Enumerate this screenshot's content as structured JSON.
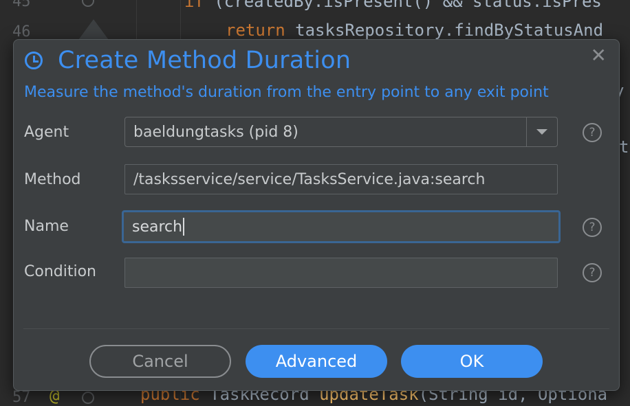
{
  "editor": {
    "line_45": {
      "number": "45",
      "code_kw": "if",
      "code_rest": " (createdBy.isPresent() && status.isPres"
    },
    "line_46": {
      "number": "46",
      "code_kw": "return",
      "code_rest": " tasksRepository.findByStatusAnd"
    },
    "line_57": {
      "number": "57",
      "annotation": "@",
      "code_kw": "public",
      "code_type": " TaskRecord ",
      "code_fn": "updateTask",
      "code_rest": "(String id, Optiona"
    },
    "right_edge_fragments": [
      "y",
      "t"
    ]
  },
  "dialog": {
    "title": "Create Method Duration",
    "subtitle": "Measure the method's duration from the entry point to any exit point",
    "close_symbol": "✕",
    "fields": {
      "agent": {
        "label": "Agent",
        "value": "baeldungtasks (pid 8)"
      },
      "method": {
        "label": "Method",
        "value": "/tasksservice/service/TasksService.java:search"
      },
      "name": {
        "label": "Name",
        "value": "search"
      },
      "condition": {
        "label": "Condition",
        "value": ""
      }
    },
    "help_symbol": "?",
    "buttons": {
      "cancel": "Cancel",
      "advanced": "Advanced",
      "ok": "OK"
    }
  },
  "colors": {
    "accent": "#3d8ff0",
    "dialog_bg": "#3c3f41",
    "editor_bg": "#2b2b2b",
    "focus_border": "#3a6694"
  },
  "icons": {
    "title_icon": "clock-icon",
    "close": "close-icon",
    "dropdown": "chevron-down-icon",
    "help": "help-icon"
  }
}
